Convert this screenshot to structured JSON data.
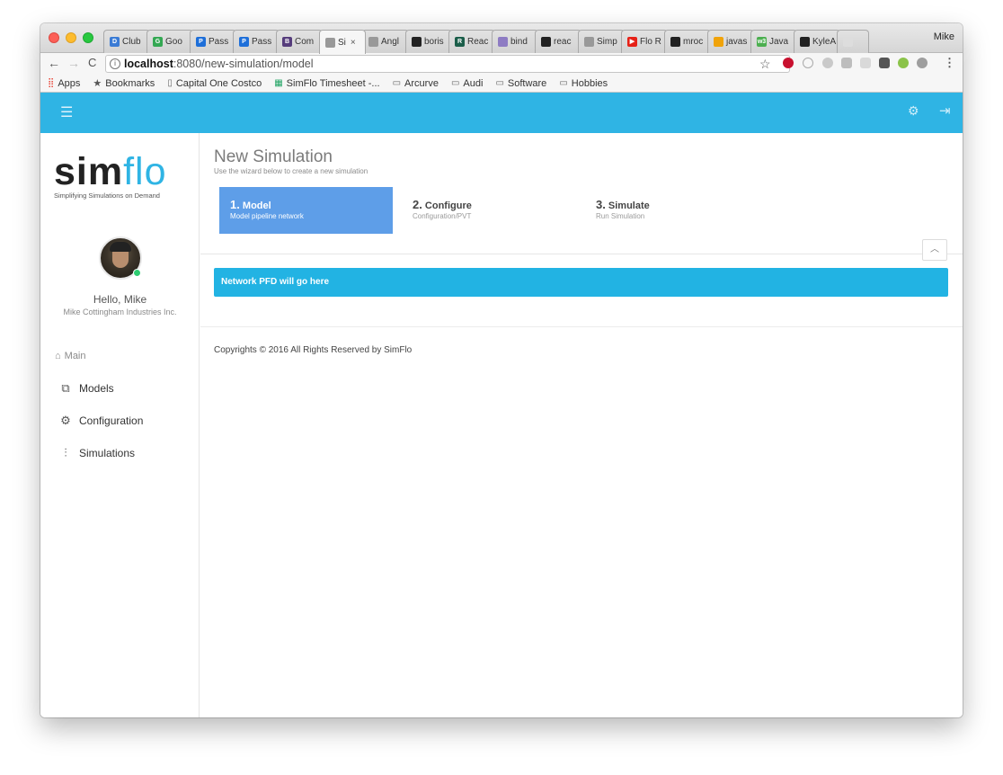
{
  "browser": {
    "tabs": [
      {
        "label": "Club",
        "color": "#3a7bd5",
        "glyph": "D"
      },
      {
        "label": "Goo",
        "color": "#34a853",
        "glyph": "G"
      },
      {
        "label": "Pass",
        "color": "#1e6fd9",
        "glyph": "P"
      },
      {
        "label": "Pass",
        "color": "#1e6fd9",
        "glyph": "P"
      },
      {
        "label": "Com",
        "color": "#563d7c",
        "glyph": "B"
      },
      {
        "label": "Si",
        "color": "#999999",
        "glyph": ""
      },
      {
        "label": "Angl",
        "color": "#999999",
        "glyph": ""
      },
      {
        "label": "boris",
        "color": "#222222",
        "glyph": ""
      },
      {
        "label": "Reac",
        "color": "#1b5e4a",
        "glyph": "R"
      },
      {
        "label": "bind",
        "color": "#8e7cc3",
        "glyph": ""
      },
      {
        "label": "reac",
        "color": "#222222",
        "glyph": ""
      },
      {
        "label": "Simp",
        "color": "#999999",
        "glyph": ""
      },
      {
        "label": "Flo R",
        "color": "#e62117",
        "glyph": "▶"
      },
      {
        "label": "mroc",
        "color": "#222222",
        "glyph": ""
      },
      {
        "label": "javas",
        "color": "#f0a30a",
        "glyph": ""
      },
      {
        "label": "Java",
        "color": "#4caf50",
        "glyph": "w3"
      },
      {
        "label": "KyleA",
        "color": "#222222",
        "glyph": ""
      },
      {
        "label": "",
        "color": "#dddddd",
        "glyph": ""
      }
    ],
    "active_tab_index": 5,
    "active_tab_close": "×",
    "profile_name": "Mike",
    "url_host": "localhost",
    "url_rest": ":8080/new-simulation/model",
    "info_glyph": "i",
    "bookmarks": [
      {
        "label": "Apps",
        "icon": "apps-icon"
      },
      {
        "label": "Bookmarks",
        "icon": "star-icon"
      },
      {
        "label": "Capital One Costco",
        "icon": "page-icon"
      },
      {
        "label": "SimFlo Timesheet -...",
        "icon": "sheet-icon"
      },
      {
        "label": "Arcurve",
        "icon": "folder-icon"
      },
      {
        "label": "Audi",
        "icon": "folder-icon"
      },
      {
        "label": "Software",
        "icon": "folder-icon"
      },
      {
        "label": "Hobbies",
        "icon": "folder-icon"
      }
    ]
  },
  "sidebar": {
    "logo_sim": "sim",
    "logo_flo": "flo",
    "logo_tagline": "Simplifying Simulations on Demand",
    "greeting": "Hello, Mike",
    "company": "Mike Cottingham Industries Inc.",
    "section_label": "Main",
    "items": [
      {
        "label": "Models",
        "icon": "models-icon"
      },
      {
        "label": "Configuration",
        "icon": "gear-icon"
      },
      {
        "label": "Simulations",
        "icon": "sliders-icon"
      }
    ]
  },
  "main": {
    "title": "New Simulation",
    "subtitle": "Use the wizard below to create a new simulation",
    "steps": [
      {
        "number": "1.",
        "title": "Model",
        "description": "Model pipeline network",
        "active": true
      },
      {
        "number": "2.",
        "title": "Configure",
        "description": "Configuration/PVT",
        "active": false
      },
      {
        "number": "3.",
        "title": "Simulate",
        "description": "Run Simulation",
        "active": false
      }
    ],
    "banner": "Network PFD will go here",
    "footer": "Copyrights © 2016 All Rights Reserved by SimFlo"
  },
  "colors": {
    "header": "#2fb4e4",
    "active_step": "#5e9ee8",
    "banner": "#22b3e3"
  }
}
